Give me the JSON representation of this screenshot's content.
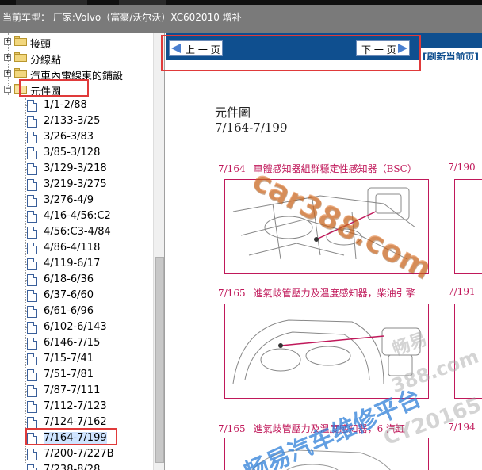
{
  "window": {
    "title": "当前车型：  厂家:Volvo（富豪/沃尔沃）XC602010 增补"
  },
  "sidebar": {
    "top_items": [
      {
        "label": "接頭",
        "expand": "+"
      },
      {
        "label": "分線點",
        "expand": "+"
      },
      {
        "label": "汽車內電線束的鋪設",
        "expand": "+"
      },
      {
        "label": "元件圖",
        "expand": "−"
      }
    ],
    "items": [
      {
        "label": "1/1-2/88"
      },
      {
        "label": "2/133-3/25"
      },
      {
        "label": "3/26-3/83"
      },
      {
        "label": "3/85-3/128"
      },
      {
        "label": "3/129-3/218"
      },
      {
        "label": "3/219-3/275"
      },
      {
        "label": "3/276-4/9"
      },
      {
        "label": "4/16-4/56:C2"
      },
      {
        "label": "4/56:C3-4/84"
      },
      {
        "label": "4/86-4/118"
      },
      {
        "label": "4/119-6/17"
      },
      {
        "label": "6/18-6/36"
      },
      {
        "label": "6/37-6/60"
      },
      {
        "label": "6/61-6/96"
      },
      {
        "label": "6/102-6/143"
      },
      {
        "label": "6/146-7/15"
      },
      {
        "label": "7/15-7/41"
      },
      {
        "label": "7/51-7/81"
      },
      {
        "label": "7/87-7/111"
      },
      {
        "label": "7/112-7/123"
      },
      {
        "label": "7/124-7/162"
      },
      {
        "label": "7/164-7/199"
      },
      {
        "label": "7/200-7/227B"
      },
      {
        "label": "7/238-8/28"
      }
    ],
    "selected_index": 21
  },
  "toolbar": {
    "prev_label": "上 一 页",
    "next_label": "下 一 页",
    "refresh_label": "[刷新当前页]"
  },
  "document": {
    "title": "元件圖",
    "subtitle": "7/164-7/199",
    "sections": [
      {
        "num": "7/164",
        "title": "車體感知器組群穩定性感知器（BSC）",
        "right_num": "7/190"
      },
      {
        "num": "7/165",
        "title": "進氣歧管壓力及溫度感知器，柴油引擎",
        "right_num": "7/191"
      },
      {
        "num": "7/165",
        "title": "進氣歧管壓力及溫度感知器，6 汽缸",
        "right_num": "7/194"
      }
    ]
  },
  "watermarks": {
    "top": "car388.com",
    "side": "畅易汽车维修平台",
    "faint1": "畅易",
    "faint2": "388.com",
    "faint3": "CY20165"
  },
  "colors": {
    "navbar": "#0f4f8f",
    "section_red": "#c0185a",
    "highlight_red": "#e03a3a",
    "watermark_blue": "#2e7fd8",
    "watermark_orange": "#e07020"
  },
  "icons": {
    "prev": "arrow-left-icon",
    "next": "arrow-right-icon",
    "folder": "folder-icon",
    "document": "document-icon"
  }
}
